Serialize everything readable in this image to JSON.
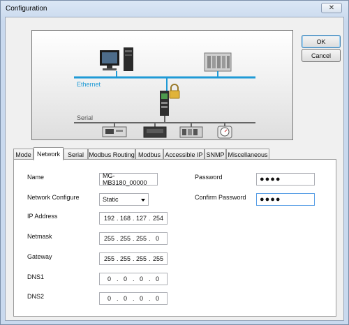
{
  "window": {
    "title": "Configuration",
    "close_glyph": "✕"
  },
  "buttons": {
    "ok": "OK",
    "cancel": "Cancel"
  },
  "diagram": {
    "ethernet_label": "Ethernet",
    "serial_label": "Serial",
    "colors": {
      "ethernet": "#1f9ad6",
      "serial": "#666666"
    }
  },
  "tabs": [
    "Mode",
    "Network",
    "Serial",
    "Modbus Routing",
    "Modbus",
    "Accessible IP",
    "SNMP",
    "Miscellaneous"
  ],
  "active_tab": "Network",
  "form": {
    "name_label": "Name",
    "name_value": "MG-MB3180_00000",
    "network_configure_label": "Network Configure",
    "network_configure_value": "Static",
    "ip_label": "IP Address",
    "ip": [
      "192",
      "168",
      "127",
      "254"
    ],
    "netmask_label": "Netmask",
    "netmask": [
      "255",
      "255",
      "255",
      "0"
    ],
    "gateway_label": "Gateway",
    "gateway": [
      "255",
      "255",
      "255",
      "255"
    ],
    "dns1_label": "DNS1",
    "dns1": [
      "0",
      "0",
      "0",
      "0"
    ],
    "dns2_label": "DNS2",
    "dns2": [
      "0",
      "0",
      "0",
      "0"
    ],
    "password_label": "Password",
    "password_value": "●●●●",
    "confirm_password_label": "Confirm Password",
    "confirm_password_value": "●●●●"
  }
}
